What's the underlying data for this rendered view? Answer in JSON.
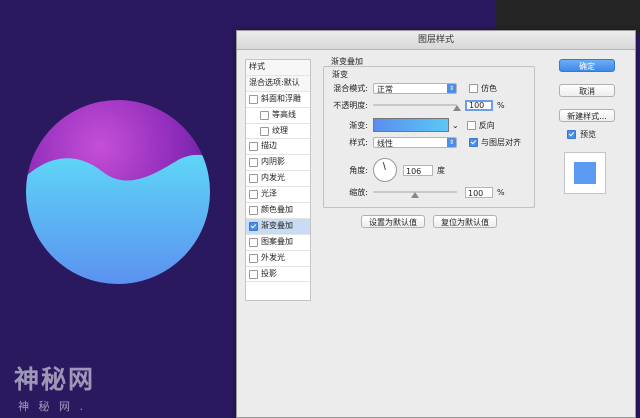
{
  "dialog": {
    "title": "图层样式",
    "left_panel": {
      "header": "样式",
      "blend_defaults": "混合选项:默认",
      "items": [
        {
          "label": "斜面和浮雕",
          "checked": false,
          "indent": false
        },
        {
          "label": "等高线",
          "checked": false,
          "indent": true
        },
        {
          "label": "纹理",
          "checked": false,
          "indent": true
        },
        {
          "label": "描边",
          "checked": false,
          "indent": false
        },
        {
          "label": "内阴影",
          "checked": false,
          "indent": false
        },
        {
          "label": "内发光",
          "checked": false,
          "indent": false
        },
        {
          "label": "光泽",
          "checked": false,
          "indent": false
        },
        {
          "label": "颜色叠加",
          "checked": false,
          "indent": false
        },
        {
          "label": "渐变叠加",
          "checked": true,
          "indent": false,
          "selected": true
        },
        {
          "label": "图案叠加",
          "checked": false,
          "indent": false
        },
        {
          "label": "外发光",
          "checked": false,
          "indent": false
        },
        {
          "label": "投影",
          "checked": false,
          "indent": false
        }
      ]
    },
    "section_title": "渐变叠加",
    "subsection_title": "渐变",
    "blend_mode": {
      "label": "混合模式:",
      "value": "正常"
    },
    "dither": {
      "label": "仿色",
      "checked": false
    },
    "opacity": {
      "label": "不透明度:",
      "value": "100",
      "unit": "%",
      "level": 1.0
    },
    "gradient": {
      "label": "渐变:",
      "colors": [
        "#5b8def",
        "#5ac8f5"
      ]
    },
    "reverse": {
      "label": "反向",
      "checked": false
    },
    "style": {
      "label": "样式:",
      "value": "线性"
    },
    "align_with_layer": {
      "label": "与图层对齐",
      "checked": true
    },
    "angle": {
      "label": "角度:",
      "value": "106",
      "unit": "度"
    },
    "scale": {
      "label": "缩放:",
      "value": "100",
      "unit": "%",
      "level": 0.5
    },
    "make_default": "设置为默认值",
    "reset_default": "复位为默认值",
    "ok": "确定",
    "cancel": "取消",
    "new_style": "新建样式...",
    "preview": {
      "label": "预览",
      "checked": true,
      "color": "#5a9af0"
    }
  },
  "watermark": {
    "main": "神秘网",
    "sub": "神 秘 网 ."
  },
  "colors": {
    "canvas": "#2b1960",
    "accent": "#4a8ee8"
  }
}
